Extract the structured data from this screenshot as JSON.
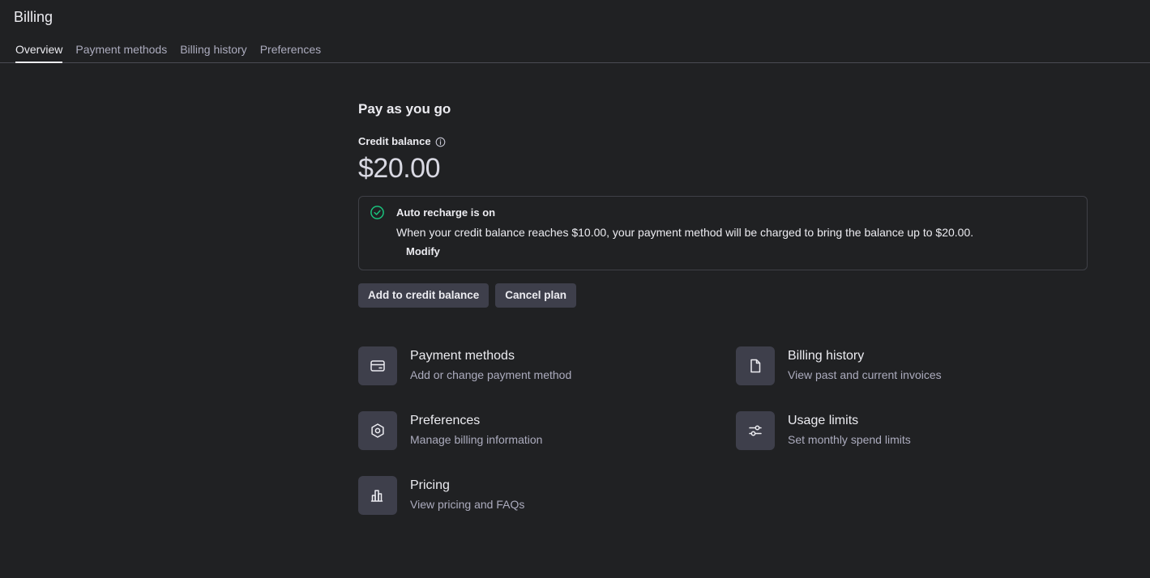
{
  "page": {
    "title": "Billing"
  },
  "tabs": [
    {
      "label": "Overview",
      "active": true
    },
    {
      "label": "Payment methods",
      "active": false
    },
    {
      "label": "Billing history",
      "active": false
    },
    {
      "label": "Preferences",
      "active": false
    }
  ],
  "plan": {
    "title": "Pay as you go",
    "credit_label": "Credit balance",
    "credit_amount": "$20.00"
  },
  "auto_recharge": {
    "title": "Auto recharge is on",
    "description": "When your credit balance reaches $10.00, your payment method will be charged to bring the balance up to $20.00.",
    "modify_label": "Modify",
    "status_color": "#19c37d"
  },
  "actions": {
    "add_credit_label": "Add to credit balance",
    "cancel_label": "Cancel plan"
  },
  "cards": [
    {
      "icon": "credit-card-icon",
      "title": "Payment methods",
      "subtitle": "Add or change payment method"
    },
    {
      "icon": "document-icon",
      "title": "Billing history",
      "subtitle": "View past and current invoices"
    },
    {
      "icon": "gear-icon",
      "title": "Preferences",
      "subtitle": "Manage billing information"
    },
    {
      "icon": "sliders-icon",
      "title": "Usage limits",
      "subtitle": "Set monthly spend limits"
    },
    {
      "icon": "bar-chart-icon",
      "title": "Pricing",
      "subtitle": "View pricing and FAQs"
    }
  ]
}
